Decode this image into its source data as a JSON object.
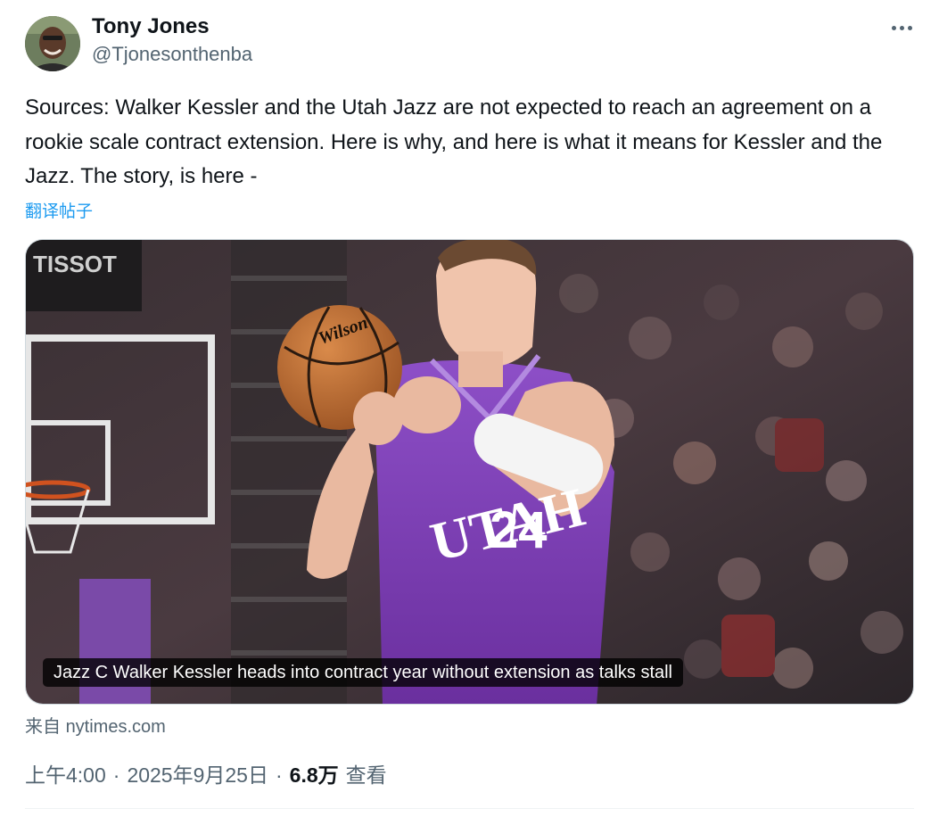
{
  "author": {
    "name": "Tony Jones",
    "handle": "@Tjonesonthenba"
  },
  "tweet": {
    "text": "Sources: Walker Kessler and the Utah Jazz are not expected to reach an agreement on a rookie scale contract extension. Here is why, and here is what it means for Kessler and the Jazz. The story, is here -",
    "translate_label": "翻译帖子"
  },
  "media": {
    "caption": "Jazz C Walker Kessler heads into contract year without extension as talks stall",
    "jersey_team": "UTAH",
    "jersey_number": "24",
    "ball_brand": "Wilson",
    "arena_sign": "TISSOT"
  },
  "source": {
    "prefix": "来自",
    "domain": "nytimes.com"
  },
  "meta": {
    "time": "上午4:00",
    "separator": "·",
    "date": "2025年9月25日",
    "views_count": "6.8万",
    "views_label": "查看"
  },
  "colors": {
    "text": "#0f1419",
    "secondary": "#536471",
    "link": "#1d9bf0",
    "jersey": "#7a3fb0"
  },
  "icons": {
    "more": "more-horizontal-icon"
  }
}
